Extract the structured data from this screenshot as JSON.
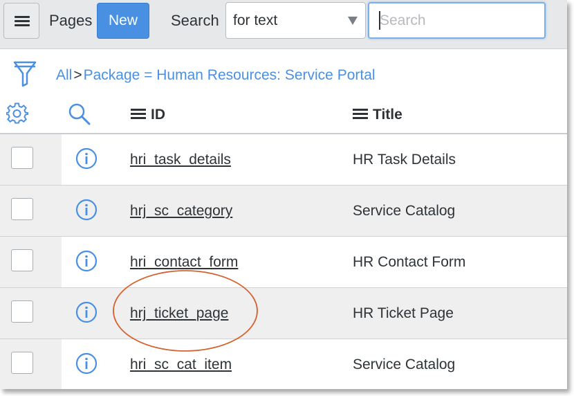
{
  "header": {
    "pages_label": "Pages",
    "new_label": "New",
    "search_label": "Search",
    "search_field_selected": "for text",
    "search_placeholder": "Search"
  },
  "breadcrumb": {
    "all": "All",
    "separator": ">",
    "filter": "Package = Human Resources: Service Portal"
  },
  "columns": {
    "id": "ID",
    "title": "Title"
  },
  "rows": [
    {
      "id": "hri_task_details",
      "title": "HR Task Details"
    },
    {
      "id": "hrj_sc_category",
      "title": "Service Catalog"
    },
    {
      "id": "hri_contact_form",
      "title": "HR Contact Form"
    },
    {
      "id": "hrj_ticket_page",
      "title": "HR Ticket Page"
    },
    {
      "id": "hri_sc_cat_item",
      "title": "Service Catalog"
    }
  ],
  "icons": {
    "menu": "hamburger-icon",
    "filter": "funnel-icon",
    "settings": "gear-icon",
    "search": "magnifier-icon",
    "info": "info-icon"
  },
  "colors": {
    "accent": "#4a90e2",
    "highlight": "#d4622e"
  }
}
